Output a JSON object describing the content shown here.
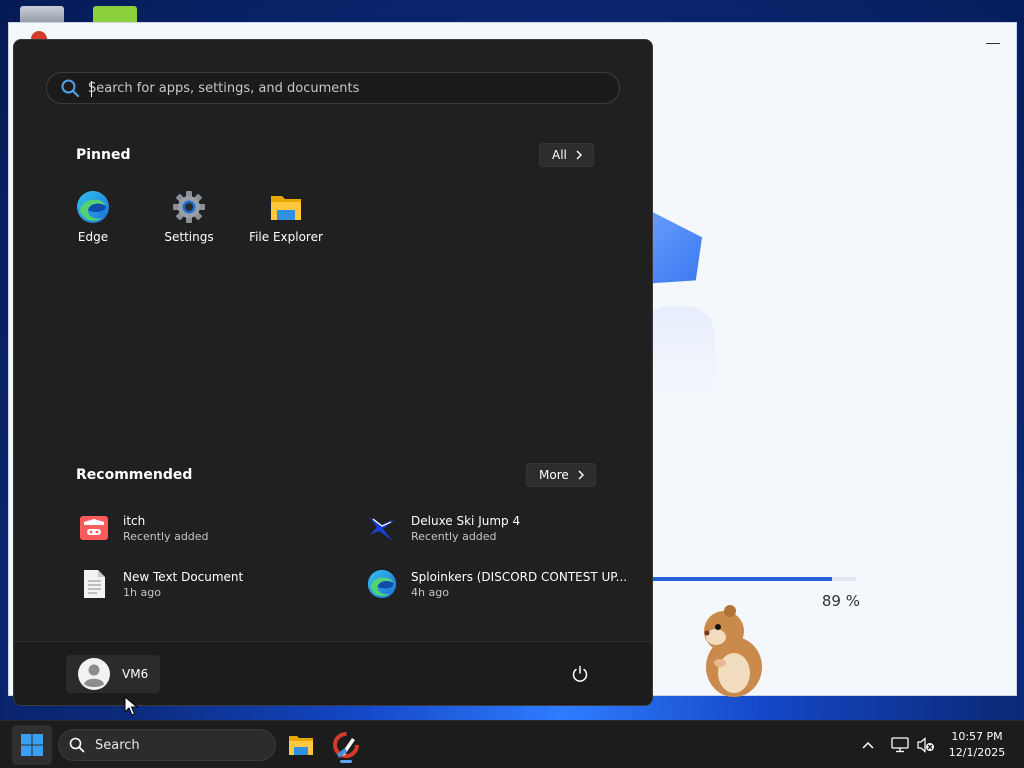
{
  "desktop": {
    "icons": [
      {
        "name": "recycle-bin-icon"
      },
      {
        "name": "game-icon"
      }
    ]
  },
  "background_window": {
    "progress_value": 0.89,
    "progress_label": "89 %"
  },
  "start_menu": {
    "search": {
      "placeholder": "Search for apps, settings, and documents",
      "value": ""
    },
    "pinned": {
      "title": "Pinned",
      "all_button": "All",
      "apps": [
        {
          "label": "Edge",
          "icon": "edge-icon"
        },
        {
          "label": "Settings",
          "icon": "settings-gear-icon"
        },
        {
          "label": "File Explorer",
          "icon": "folder-icon"
        }
      ]
    },
    "recommended": {
      "title": "Recommended",
      "more_button": "More",
      "items": [
        {
          "name": "itch",
          "sub": "Recently added",
          "icon": "itch-icon"
        },
        {
          "name": "Deluxe Ski Jump 4",
          "sub": "Recently added",
          "icon": "ski-jumper-icon"
        },
        {
          "name": "New Text Document",
          "sub": "1h ago",
          "icon": "text-document-icon"
        },
        {
          "name": "Sploinkers (DISCORD CONTEST UP...",
          "sub": "4h ago",
          "icon": "edge-icon"
        }
      ]
    },
    "footer": {
      "user_name": "VM6"
    }
  },
  "taskbar": {
    "search_label": "Search",
    "clock_time": "10:57 PM",
    "clock_date": "12/1/2025"
  },
  "colors": {
    "accent": "#60a5fa",
    "progress": "#2563d6",
    "menu_bg": "#202020"
  }
}
